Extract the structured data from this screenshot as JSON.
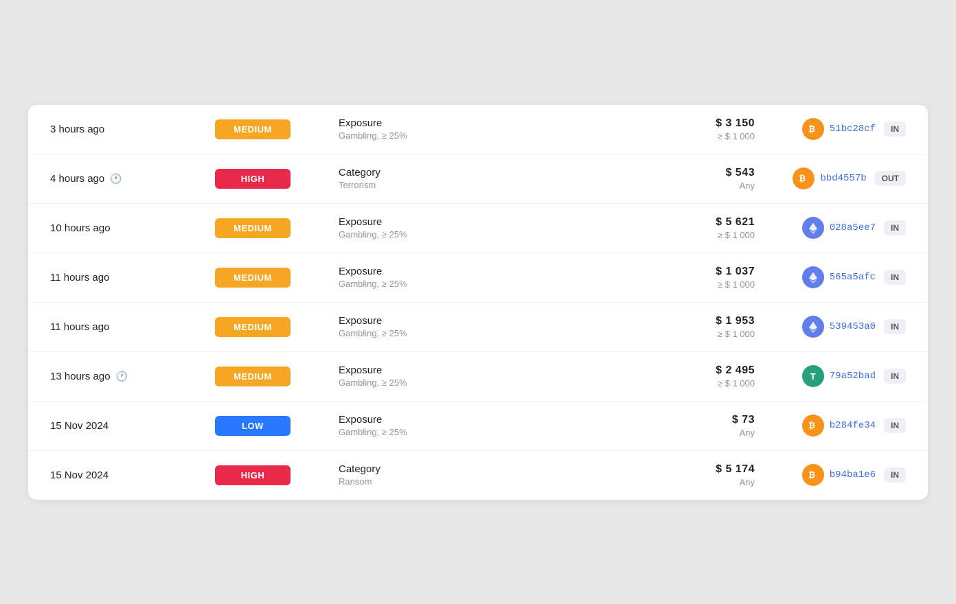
{
  "rows": [
    {
      "time": "3 hours ago",
      "showClock": false,
      "badge": "MEDIUM",
      "badgeType": "medium",
      "typeLabel": "Exposure",
      "typeSub": "Gambling, ≥ 25%",
      "amount": "$ 3 150",
      "amountSub": "≥ $ 1 000",
      "cryptoType": "btc",
      "cryptoSymbol": "₿",
      "hash": "51bc28cf",
      "direction": "IN"
    },
    {
      "time": "4 hours ago",
      "showClock": true,
      "badge": "HIGH",
      "badgeType": "high",
      "typeLabel": "Category",
      "typeSub": "Terrorism",
      "amount": "$ 543",
      "amountSub": "Any",
      "cryptoType": "btc",
      "cryptoSymbol": "₿",
      "hash": "bbd4557b",
      "direction": "OUT"
    },
    {
      "time": "10 hours ago",
      "showClock": false,
      "badge": "MEDIUM",
      "badgeType": "medium",
      "typeLabel": "Exposure",
      "typeSub": "Gambling, ≥ 25%",
      "amount": "$ 5 621",
      "amountSub": "≥ $ 1 000",
      "cryptoType": "eth",
      "cryptoSymbol": "◆",
      "hash": "028a5ee7",
      "direction": "IN"
    },
    {
      "time": "11 hours ago",
      "showClock": false,
      "badge": "MEDIUM",
      "badgeType": "medium",
      "typeLabel": "Exposure",
      "typeSub": "Gambling, ≥ 25%",
      "amount": "$ 1 037",
      "amountSub": "≥ $ 1 000",
      "cryptoType": "eth",
      "cryptoSymbol": "◆",
      "hash": "565a5afc",
      "direction": "IN"
    },
    {
      "time": "11 hours ago",
      "showClock": false,
      "badge": "MEDIUM",
      "badgeType": "medium",
      "typeLabel": "Exposure",
      "typeSub": "Gambling, ≥ 25%",
      "amount": "$ 1 953",
      "amountSub": "≥ $ 1 000",
      "cryptoType": "eth",
      "cryptoSymbol": "◆",
      "hash": "539453a0",
      "direction": "IN"
    },
    {
      "time": "13 hours ago",
      "showClock": true,
      "badge": "MEDIUM",
      "badgeType": "medium",
      "typeLabel": "Exposure",
      "typeSub": "Gambling, ≥ 25%",
      "amount": "$ 2 495",
      "amountSub": "≥ $ 1 000",
      "cryptoType": "usdt",
      "cryptoSymbol": "T",
      "hash": "79a52bad",
      "direction": "IN"
    },
    {
      "time": "15 Nov 2024",
      "showClock": false,
      "badge": "LOW",
      "badgeType": "low",
      "typeLabel": "Exposure",
      "typeSub": "Gambling, ≥ 25%",
      "amount": "$ 73",
      "amountSub": "Any",
      "cryptoType": "btc",
      "cryptoSymbol": "₿",
      "hash": "b284fe34",
      "direction": "IN"
    },
    {
      "time": "15 Nov 2024",
      "showClock": false,
      "badge": "HIGH",
      "badgeType": "high",
      "typeLabel": "Category",
      "typeSub": "Ransom",
      "amount": "$ 5 174",
      "amountSub": "Any",
      "cryptoType": "btc",
      "cryptoSymbol": "₿",
      "hash": "b94ba1e6",
      "direction": "IN"
    }
  ],
  "cryptoColors": {
    "btc": "#f7931a",
    "eth": "#627eea",
    "usdt": "#26a17b"
  }
}
